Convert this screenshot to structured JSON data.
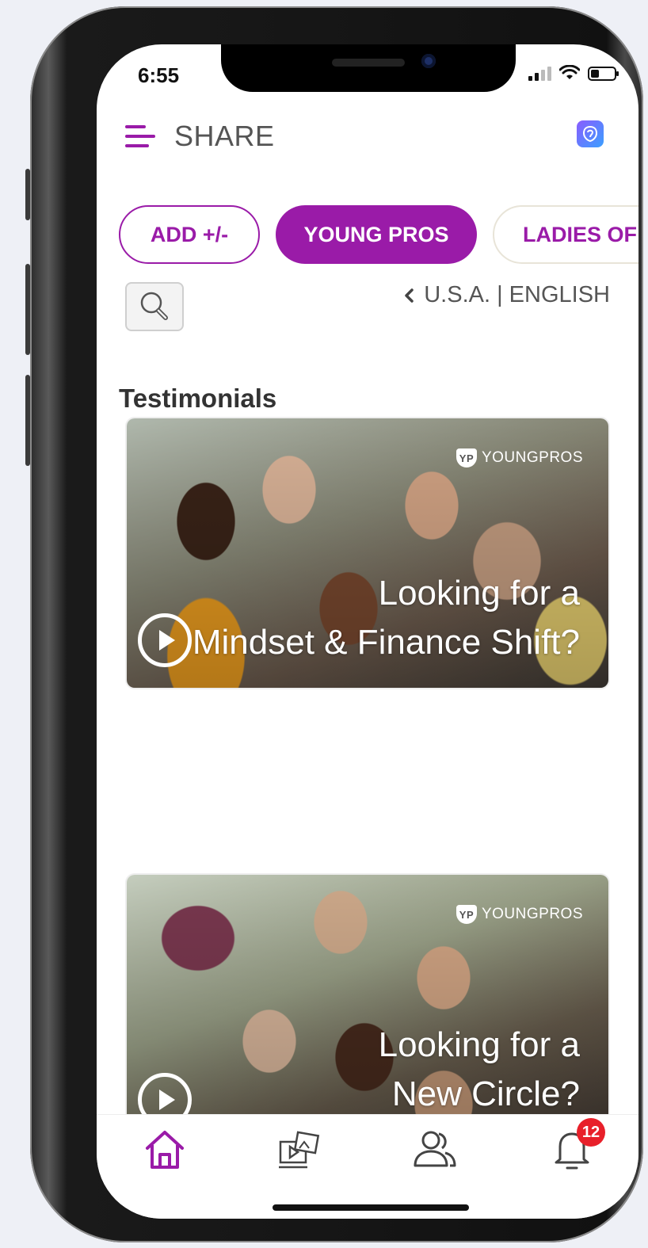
{
  "status_bar": {
    "time": "6:55"
  },
  "header": {
    "title": "SHARE"
  },
  "tabs": [
    {
      "label": "ADD +/-"
    },
    {
      "label": "YOUNG PROS"
    },
    {
      "label": "LADIES OF"
    }
  ],
  "locale": {
    "label": "U.S.A. | ENGLISH"
  },
  "section": {
    "title": "Testimonials"
  },
  "videos": [
    {
      "brand": "YOUNGPROS",
      "line1": "Looking for a",
      "line2": "Mindset & Finance Shift?"
    },
    {
      "brand": "YOUNGPROS",
      "line1": "Looking for a",
      "line2": "New Circle?"
    }
  ],
  "bottom_nav": {
    "items": [
      {
        "name": "home-icon"
      },
      {
        "name": "media-library-icon"
      },
      {
        "name": "people-icon"
      },
      {
        "name": "bell-icon"
      }
    ],
    "notification_count": "12"
  },
  "colors": {
    "accent": "#9a1ba8",
    "badge": "#e8202a"
  }
}
